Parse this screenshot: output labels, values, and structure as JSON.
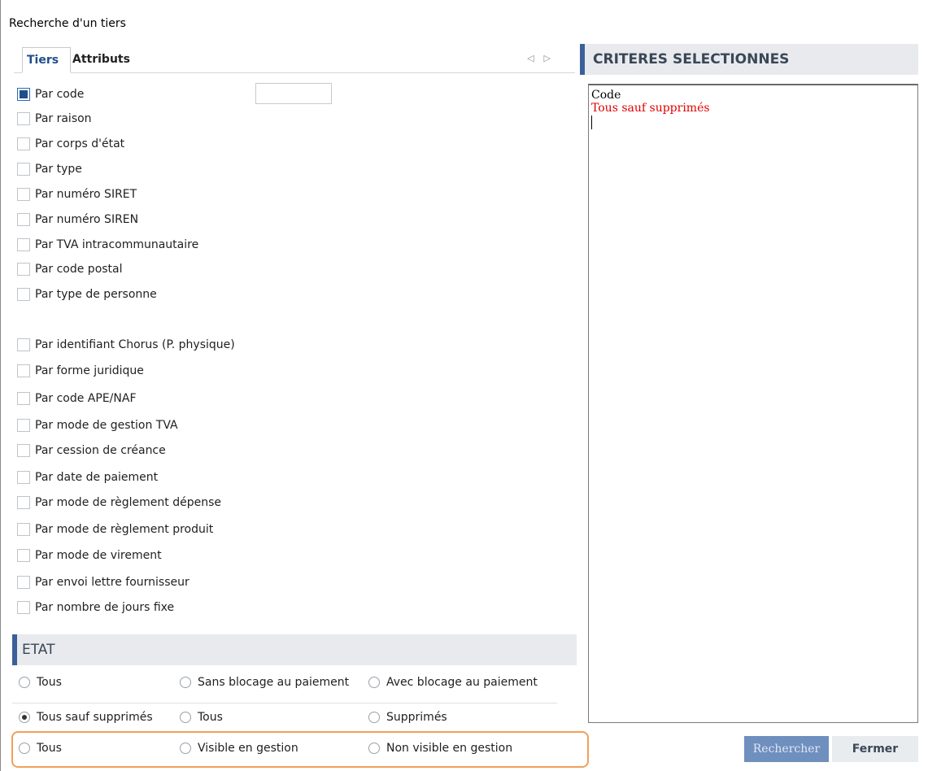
{
  "window": {
    "title": "Recherche d'un tiers"
  },
  "tabs": [
    {
      "label": "Tiers",
      "active": true
    },
    {
      "label": "Attributs",
      "active": false
    }
  ],
  "tab_nav": {
    "prev_icon": "triangle-left-icon",
    "next_icon": "triangle-right-icon",
    "prev": "◁",
    "next": "▷"
  },
  "criteria_list": {
    "items": [
      {
        "label": "Par code",
        "checked": true
      },
      {
        "label": "Par raison",
        "checked": false
      },
      {
        "label": "Par corps d'état",
        "checked": false
      },
      {
        "label": "Par type",
        "checked": false
      },
      {
        "label": "Par numéro SIRET",
        "checked": false
      },
      {
        "label": "Par numéro SIREN",
        "checked": false
      },
      {
        "label": "Par TVA intracommunautaire",
        "checked": false
      },
      {
        "label": "Par code postal",
        "checked": false
      },
      {
        "label": "Par type de personne",
        "checked": false
      },
      {
        "label": "Par identifiant Chorus (P. physique)",
        "checked": false
      },
      {
        "label": "Par forme juridique",
        "checked": false
      },
      {
        "label": "Par code APE/NAF",
        "checked": false
      },
      {
        "label": "Par mode de gestion TVA",
        "checked": false
      },
      {
        "label": "Par cession de créance",
        "checked": false
      },
      {
        "label": "Par date de paiement",
        "checked": false
      },
      {
        "label": "Par mode de règlement dépense",
        "checked": false
      },
      {
        "label": "Par mode de règlement produit",
        "checked": false
      },
      {
        "label": "Par mode de virement",
        "checked": false
      },
      {
        "label": "Par envoi lettre fournisseur",
        "checked": false
      },
      {
        "label": "Par nombre de jours fixe",
        "checked": false
      }
    ],
    "code_input_value": ""
  },
  "etat": {
    "header": "ETAT",
    "row1": [
      {
        "label": "Tous",
        "selected": false
      },
      {
        "label": "Sans blocage au paiement",
        "selected": false
      },
      {
        "label": "Avec blocage au paiement",
        "selected": false
      }
    ],
    "row2": [
      {
        "label": "Tous sauf supprimés",
        "selected": true
      },
      {
        "label": "Tous",
        "selected": false
      },
      {
        "label": "Supprimés",
        "selected": false
      }
    ],
    "row3": [
      {
        "label": "Tous",
        "selected": false
      },
      {
        "label": "Visible en gestion",
        "selected": false
      },
      {
        "label": "Non visible en gestion",
        "selected": false
      }
    ],
    "highlight_color": "#f0a05a"
  },
  "criteres": {
    "header": "CRITERES SELECTIONNES",
    "lines": [
      "Code",
      "Tous sauf supprimés"
    ],
    "line_colors": [
      "#000000",
      "#e00000"
    ]
  },
  "buttons": {
    "search": "Rechercher",
    "close": "Fermer"
  },
  "colors": {
    "accent": "#3b5f9a",
    "tab_active": "#1f4e8c",
    "header_bg": "#e8eaee",
    "search_button_bg": "#6f8fbf"
  }
}
